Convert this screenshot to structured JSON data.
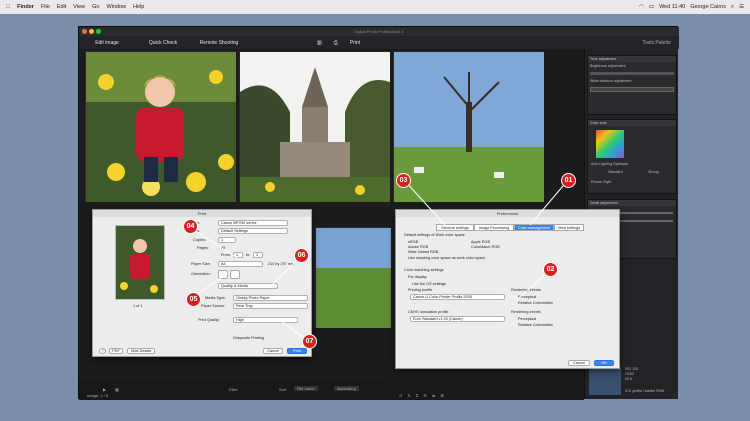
{
  "menubar": {
    "apple": "",
    "app": "Finder",
    "items": [
      "File",
      "Edit",
      "View",
      "Go",
      "Window",
      "Help"
    ],
    "clock": "Wed 11:40",
    "user": "George Cairns"
  },
  "window": {
    "title": "Digital Photo Professional 4",
    "tabs": [
      "Edit image",
      "Quick Check",
      "Remote Shooting"
    ],
    "center_buttons": [
      "Print"
    ],
    "right_label": "Tools Palette"
  },
  "callouts": [
    "01",
    "02",
    "03",
    "04",
    "05",
    "06",
    "07"
  ],
  "print_dialog": {
    "title": "Print",
    "printer_label": "Printer:",
    "printer": "Canon MP230 series",
    "presets_label": "Presets:",
    "presets": "Default Settings",
    "copies_label": "Copies:",
    "copies": "1",
    "pages_label": "Pages:",
    "pages_all": "All",
    "from_label": "From:",
    "from": "1",
    "to_label": "to:",
    "to": "1",
    "paper_label": "Paper Size:",
    "paper": "A4",
    "paper_dims": "210 by 297 mm",
    "orient_label": "Orientation:",
    "section": "Quality & Media",
    "media_label": "Media Type:",
    "media": "Glossy Photo Paper",
    "source_label": "Paper Source:",
    "source": "Rear Tray",
    "quality_label": "Print Quality:",
    "quality": "High",
    "grayscale": "Grayscale Printing",
    "page_indicator": "1 of 1",
    "help": "?",
    "pdf": "PDF",
    "hide_details": "Hide Details",
    "cancel": "Cancel",
    "print": "Print"
  },
  "preferences": {
    "title": "Preferences",
    "tabs": [
      "General settings",
      "Image Processing",
      "Color management",
      "View settings"
    ],
    "work_space_label": "Default settings of Work color space",
    "spaces": [
      "sRGB",
      "Adobe RGB",
      "Wide Gamut RGB",
      "Apple RGB",
      "ColorMatch RGB"
    ],
    "ext_space": "Use shooting color space as work color space",
    "matching_label": "Color matching settings",
    "display": "For display",
    "use_os": "Use the OS settings",
    "printing_profile_label": "Printing profile",
    "printing_profile": "Canon IJ Color Printer Profile 2005",
    "cmyk_label": "CMYK simulation profile",
    "cmyk": "Euro Standard v1.00 (Canon)",
    "intent_label": "Rendering intents",
    "intent_options": [
      "Perceptual",
      "Relative Colorimetric"
    ],
    "cancel": "Cancel",
    "ok": "OK"
  },
  "right_panel": {
    "sections": [
      "Tone adjustment",
      "Brightness adjustment",
      "White balance adjustment",
      "Color tone",
      "Picture Style",
      "Detail adjustment"
    ],
    "hsl_labels": [
      "Auto Lighting Optimizer",
      "Standard",
      "Strong"
    ],
    "footer": "ICC profile / Adobe RGB",
    "info": [
      "ISO 100",
      "1/250",
      "f/5.6"
    ]
  },
  "bottom": {
    "image_count": "Image: 1 / 8",
    "filter": "Filter",
    "sort": "Sort",
    "sort_value": "File name",
    "sort_order": "Ascending"
  },
  "colors": {
    "accent": "#3b82f6",
    "callout": "#d4231f",
    "bg": "#1b1c1e"
  }
}
